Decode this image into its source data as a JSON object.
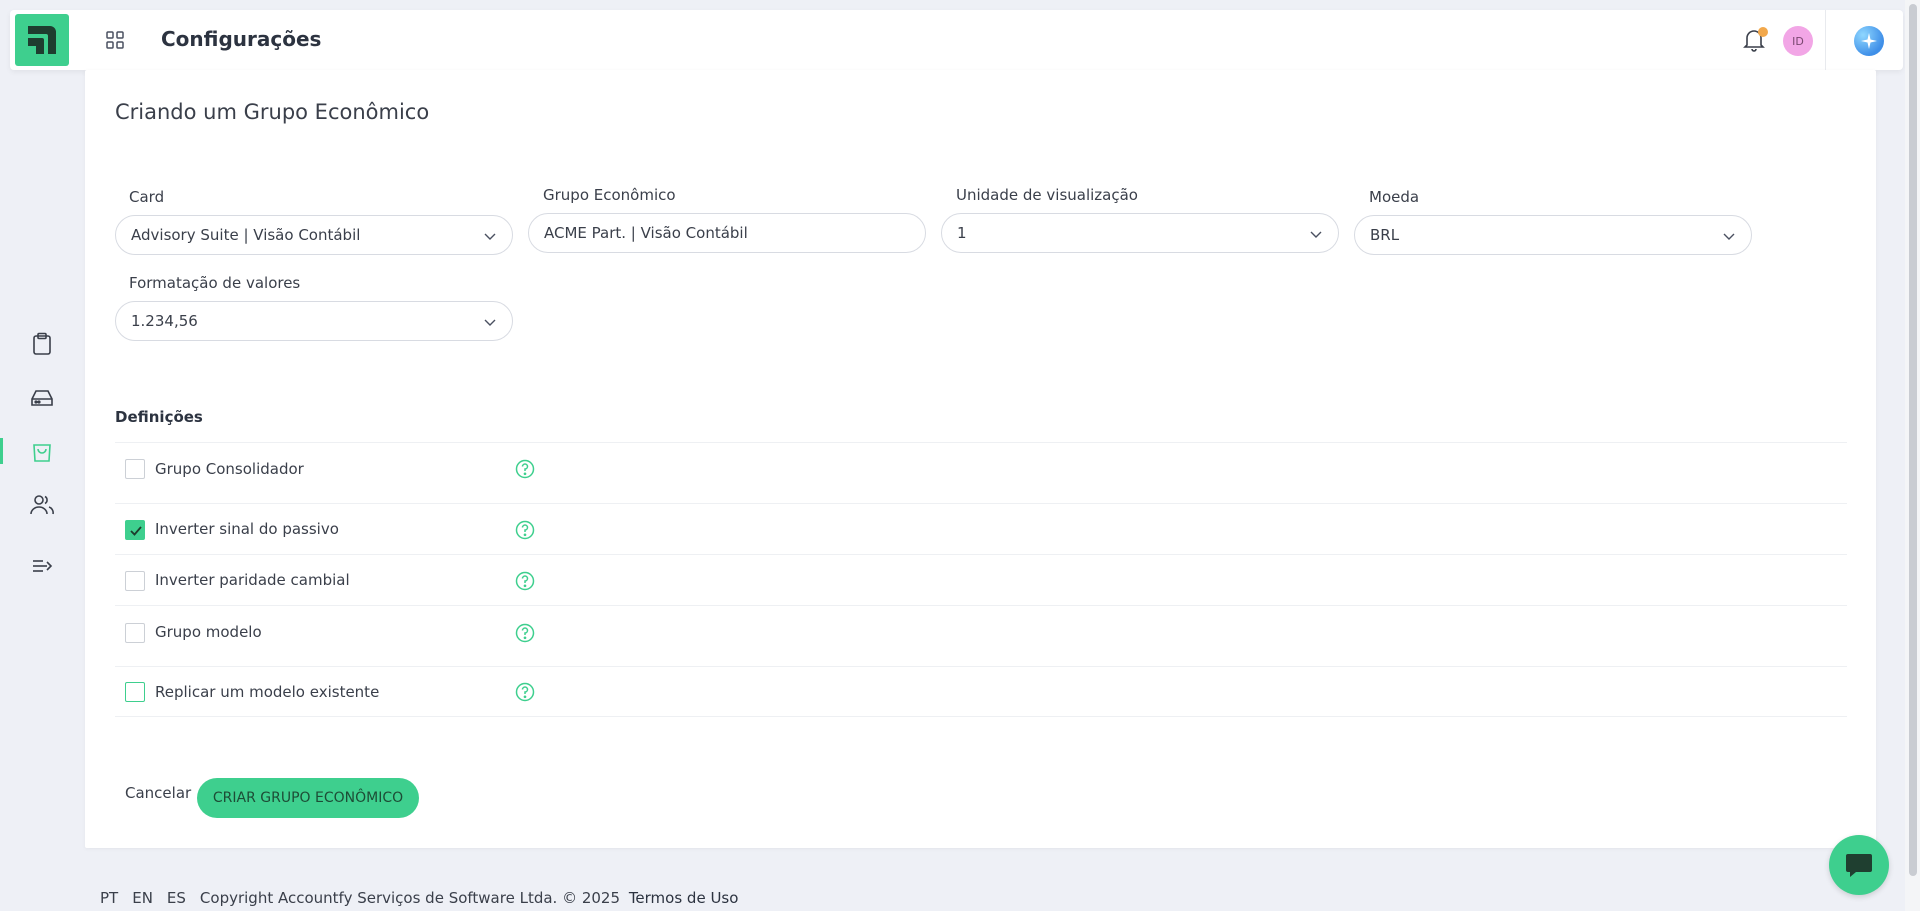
{
  "header": {
    "title": "Configurações",
    "avatar_initials": "ID",
    "accent_color": "#3ecf8e",
    "notification_dot_color": "#f2a84b",
    "icons": [
      "logo-icon",
      "apps-grid-icon",
      "bell-icon",
      "sparkle-ai-icon"
    ]
  },
  "sidebar": {
    "items": [
      {
        "name": "clipboard",
        "active": false
      },
      {
        "name": "drive",
        "active": false
      },
      {
        "name": "shopping-bag",
        "active": true
      },
      {
        "name": "users",
        "active": false
      },
      {
        "name": "collapse-menu",
        "active": false
      }
    ]
  },
  "form": {
    "title": "Criando um Grupo Econômico",
    "card": {
      "label": "Card",
      "value": "Advisory Suite | Visão Contábil"
    },
    "grupo": {
      "label": "Grupo Econômico",
      "value": "ACME Part. | Visão Contábil"
    },
    "unidade": {
      "label": "Unidade de visualização",
      "value": "1"
    },
    "moeda": {
      "label": "Moeda",
      "value": "BRL"
    },
    "formatacao": {
      "label": "Formatação de valores",
      "value": "1.234,56"
    }
  },
  "definitions": {
    "title": "Definições",
    "items": [
      {
        "label": "Grupo Consolidador",
        "checked": false
      },
      {
        "label": "Inverter sinal do passivo",
        "checked": true
      },
      {
        "label": "Inverter paridade cambial",
        "checked": false
      },
      {
        "label": "Grupo modelo",
        "checked": false
      },
      {
        "label": "Replicar um modelo existente",
        "checked": false
      }
    ]
  },
  "actions": {
    "cancel": "Cancelar",
    "create": "CRIAR GRUPO ECONÔMICO"
  },
  "footer": {
    "lang_pt": "PT",
    "lang_en": "EN",
    "lang_es": "ES",
    "copyright": "Copyright Accountfy Serviços de Software Ltda. © 2025",
    "terms": "Termos de Uso"
  }
}
